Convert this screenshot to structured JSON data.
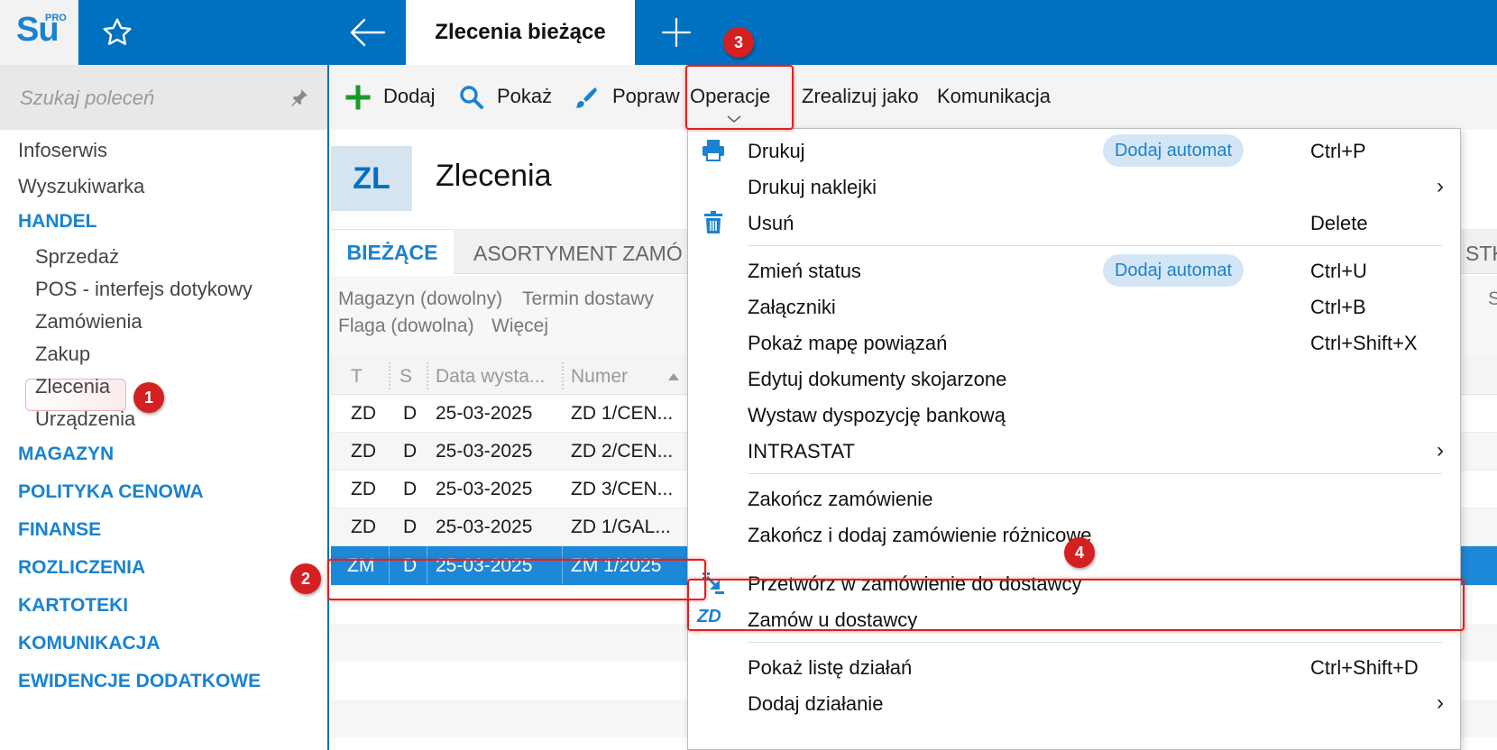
{
  "app": {
    "logo_text": "Su",
    "logo_sup": "PRO",
    "active_tab": "Zlecenia bieżące"
  },
  "sidebar": {
    "search_placeholder": "Szukaj poleceń",
    "top_items": [
      "Infoserwis",
      "Wyszukiwarka"
    ],
    "handel": {
      "label": "HANDEL",
      "items": [
        "Sprzedaż",
        "POS - interfejs dotykowy",
        "Zamówienia",
        "Zakup",
        "Zlecenia",
        "Urządzenia"
      ]
    },
    "sections": [
      "MAGAZYN",
      "POLITYKA CENOWA",
      "FINANSE",
      "ROZLICZENIA",
      "KARTOTEKI",
      "KOMUNIKACJA",
      "EWIDENCJE DODATKOWE"
    ]
  },
  "toolbar": {
    "add": "Dodaj",
    "show": "Pokaż",
    "edit": "Popraw",
    "operations": "Operacje",
    "realize_as": "Zrealizuj jako",
    "communication": "Komunikacja"
  },
  "page": {
    "badge": "ZL",
    "title": "Zlecenia"
  },
  "tabs": {
    "current": "BIEŻĄCE",
    "assortment": "ASORTYMENT ZAMÓ",
    "right_stub": "STK"
  },
  "filters": {
    "warehouse": "Magazyn (dowolny)",
    "delivery_term": "Termin dostawy",
    "flag": "Flaga (dowolna)",
    "more": "Więcej",
    "right_stub": "S"
  },
  "grid": {
    "headers": [
      "T",
      "S",
      "Data wysta...",
      "Numer"
    ],
    "rows": [
      {
        "t": "ZD",
        "s": "D",
        "date": "25-03-2025",
        "number": "ZD 1/CEN..."
      },
      {
        "t": "ZD",
        "s": "D",
        "date": "25-03-2025",
        "number": "ZD 2/CEN..."
      },
      {
        "t": "ZD",
        "s": "D",
        "date": "25-03-2025",
        "number": "ZD 3/CEN..."
      },
      {
        "t": "ZD",
        "s": "D",
        "date": "25-03-2025",
        "number": "ZD 1/GAL..."
      },
      {
        "t": "ZM",
        "s": "D",
        "date": "25-03-2025",
        "number": "ZM 1/2025"
      }
    ],
    "row_overflow": "..."
  },
  "menu": {
    "print": "Drukuj",
    "add_auto": "Dodaj automat",
    "print_shortcut": "Ctrl+P",
    "print_labels": "Drukuj naklejki",
    "delete": "Usuń",
    "delete_shortcut": "Delete",
    "change_status": "Zmień status",
    "change_status_shortcut": "Ctrl+U",
    "attachments": "Załączniki",
    "attachments_shortcut": "Ctrl+B",
    "show_map": "Pokaż mapę powiązań",
    "show_map_shortcut": "Ctrl+Shift+X",
    "edit_linked": "Edytuj dokumenty skojarzone",
    "bank_order": "Wystaw dyspozycję bankową",
    "intrastat": "INTRASTAT",
    "finish_order": "Zakończ zamówienie",
    "finish_add_diff": "Zakończ i dodaj zamówienie różnicowe",
    "convert_supplier": "Przetwórz w zamówienie do dostawcy",
    "zd_icon": "ZD",
    "order_supplier": "Zamów u dostawcy",
    "show_actions": "Pokaż listę działań",
    "show_actions_shortcut": "Ctrl+Shift+D",
    "add_action": "Dodaj działanie",
    "submenu_arrow": "›"
  },
  "callouts": [
    "1",
    "2",
    "3",
    "4"
  ],
  "colors": {
    "brand_blue": "#0070c0",
    "accent_blue": "#1a82d0",
    "selection": "#1e88d8",
    "callout_red": "#d42020"
  }
}
